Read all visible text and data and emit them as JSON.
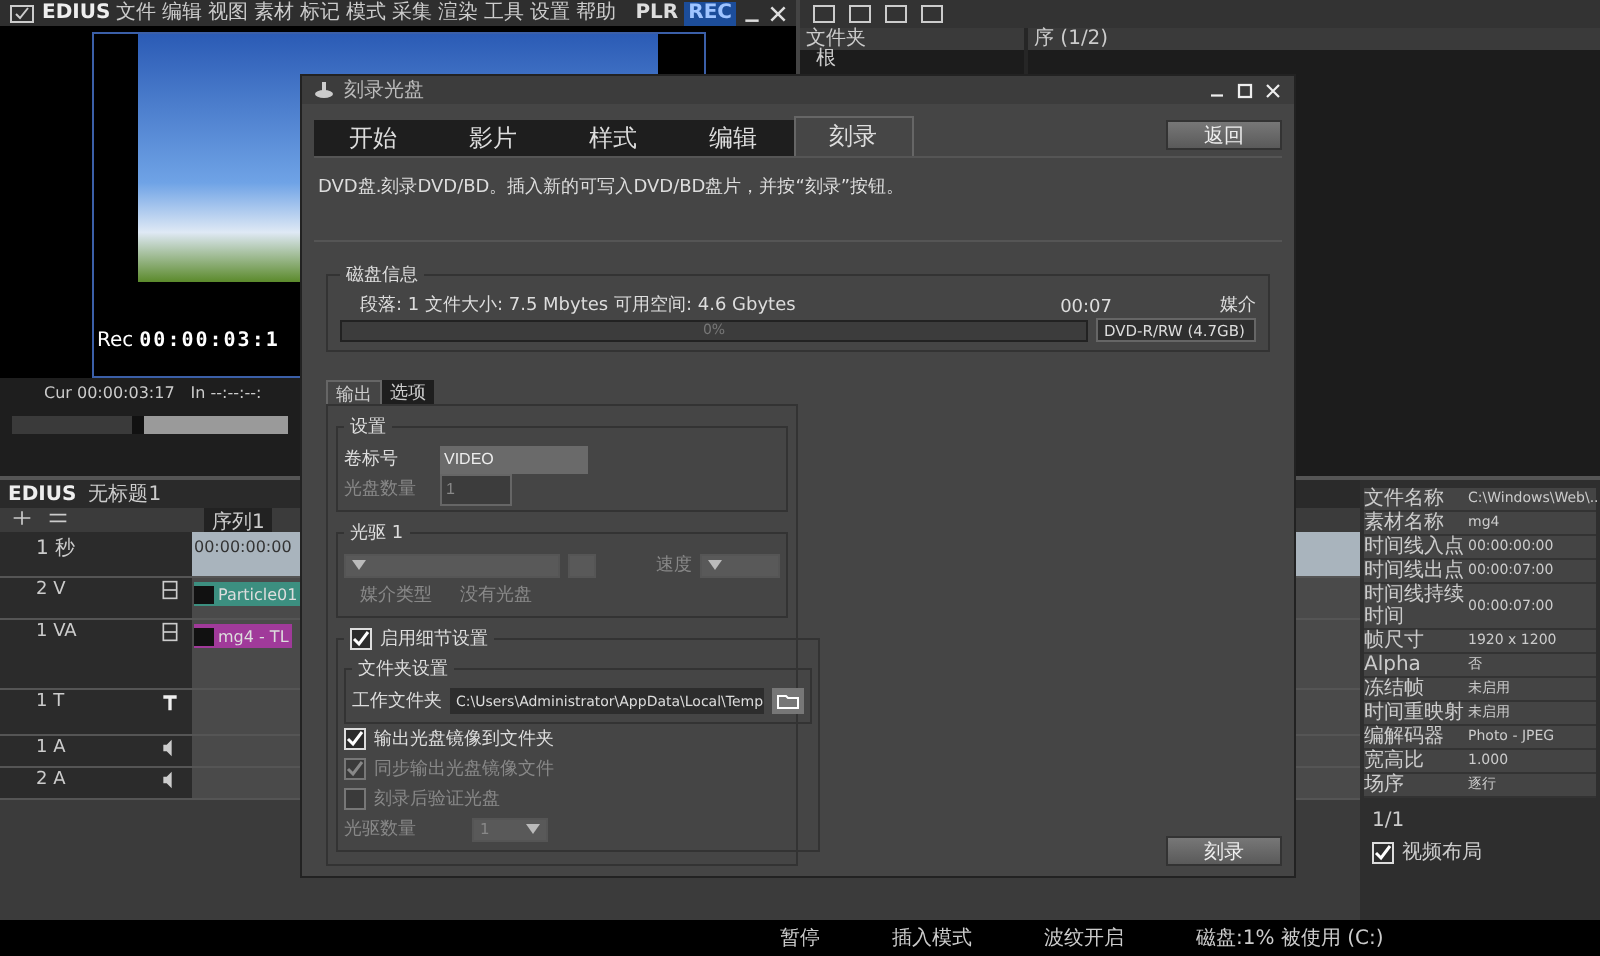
{
  "menu_bar": {
    "logo": "EDIUS",
    "items": [
      "文件",
      "编辑",
      "视图",
      "素材",
      "标记",
      "模式",
      "采集",
      "渲染",
      "工具",
      "设置",
      "帮助"
    ],
    "indicators": [
      {
        "label": "PLR",
        "selected": false
      },
      {
        "label": "REC",
        "selected": true
      }
    ]
  },
  "player": {
    "rec_label": "Rec",
    "rec_timecode": "00:00:03:1",
    "cur_label": "Cur",
    "cur_timecode": "00:00:03:17",
    "in_label": "In",
    "in_timecode": "--:--:--:"
  },
  "bin": {
    "folder_header": "文件夹",
    "folder_root": "根",
    "clip_header": "序 (1/2)"
  },
  "timeline": {
    "logo": "EDIUS",
    "project": "无标题1",
    "sequence_tab": "序列1",
    "scale": "1 秒",
    "ruler": "00:00:00:00",
    "tracks": [
      {
        "kind": "video",
        "name": "2 V",
        "clip": "Particle01"
      },
      {
        "kind": "va",
        "name": "1 VA",
        "clip": "mg4 - TL"
      },
      {
        "kind": "title",
        "name": "1 T"
      },
      {
        "kind": "audio",
        "name": "1 A"
      },
      {
        "kind": "audio",
        "name": "2 A"
      }
    ]
  },
  "info_panel": {
    "rows": [
      {
        "key": "文件名称",
        "value": "C:\\Windows\\Web\\..."
      },
      {
        "key": "素材名称",
        "value": "mg4"
      },
      {
        "key": "时间线入点",
        "value": "00:00:00:00"
      },
      {
        "key": "时间线出点",
        "value": "00:00:07:00"
      },
      {
        "key": "时间线持续时间",
        "value": "00:00:07:00"
      },
      {
        "key": "帧尺寸",
        "value": "1920 x 1200"
      },
      {
        "key": "Alpha",
        "value": "否"
      },
      {
        "key": "冻结帧",
        "value": "未启用"
      },
      {
        "key": "时间重映射",
        "value": "未启用"
      },
      {
        "key": "编解码器",
        "value": "Photo - JPEG"
      },
      {
        "key": "宽高比",
        "value": "1.000"
      },
      {
        "key": "场序",
        "value": "逐行"
      }
    ]
  },
  "layout_panel": {
    "count": "1/1",
    "items": [
      {
        "label": "视频布局",
        "checked": true
      }
    ]
  },
  "status_bar": {
    "items": [
      "暂停",
      "插入模式",
      "波纹开启",
      "磁盘:1% 被使用 (C:)"
    ]
  },
  "dialog": {
    "title": "刻录光盘",
    "tabs": [
      {
        "label": "开始",
        "selected": false
      },
      {
        "label": "影片",
        "selected": false
      },
      {
        "label": "样式",
        "selected": false
      },
      {
        "label": "编辑",
        "selected": false
      },
      {
        "label": "刻录",
        "selected": true
      }
    ],
    "back_button": "返回",
    "description": "DVD盘.刻录DVD/BD。插入新的可写入DVD/BD盘片，并按“刻录”按钮。",
    "disc_info": {
      "title": "磁盘信息",
      "summary": "段落: 1   文件大小: 7.5 Mbytes   可用空间: 4.6 Gbytes",
      "duration": "00:07",
      "media_label": "媒介",
      "progress_text": "0%",
      "level": 0,
      "media_value": "DVD-R/RW (4.7GB)"
    },
    "sub_tabs": [
      {
        "label": "输出",
        "selected": true
      },
      {
        "label": "选项",
        "selected": false
      }
    ],
    "settings": {
      "title": "设置",
      "volume_label": "卷标号",
      "volume_value": "VIDEO",
      "disc_count_label": "光盘数量",
      "disc_count_value": "1",
      "disc_count_disabled": true
    },
    "drive": {
      "title": "光驱 1",
      "speed_label": "速度",
      "media_type_label": "媒介类型",
      "media_type_value": "没有光盘",
      "disabled": true
    },
    "detail": {
      "label": "启用细节设置",
      "checked": true,
      "folder_title": "文件夹设置",
      "work_folder_label": "工作文件夹",
      "work_folder_value": "C:\\Users\\Administrator\\AppData\\Local\\Temp",
      "options": [
        {
          "label": "输出光盘镜像到文件夹",
          "checked": true,
          "disabled": false
        },
        {
          "label": "同步输出光盘镜像文件",
          "checked": true,
          "disabled": true
        },
        {
          "label": "刻录后验证光盘",
          "checked": false,
          "disabled": true
        }
      ],
      "drive_count_label": "光驱数量",
      "drive_count_value": "1",
      "drive_count_disabled": true
    },
    "burn_button": "刻录"
  }
}
